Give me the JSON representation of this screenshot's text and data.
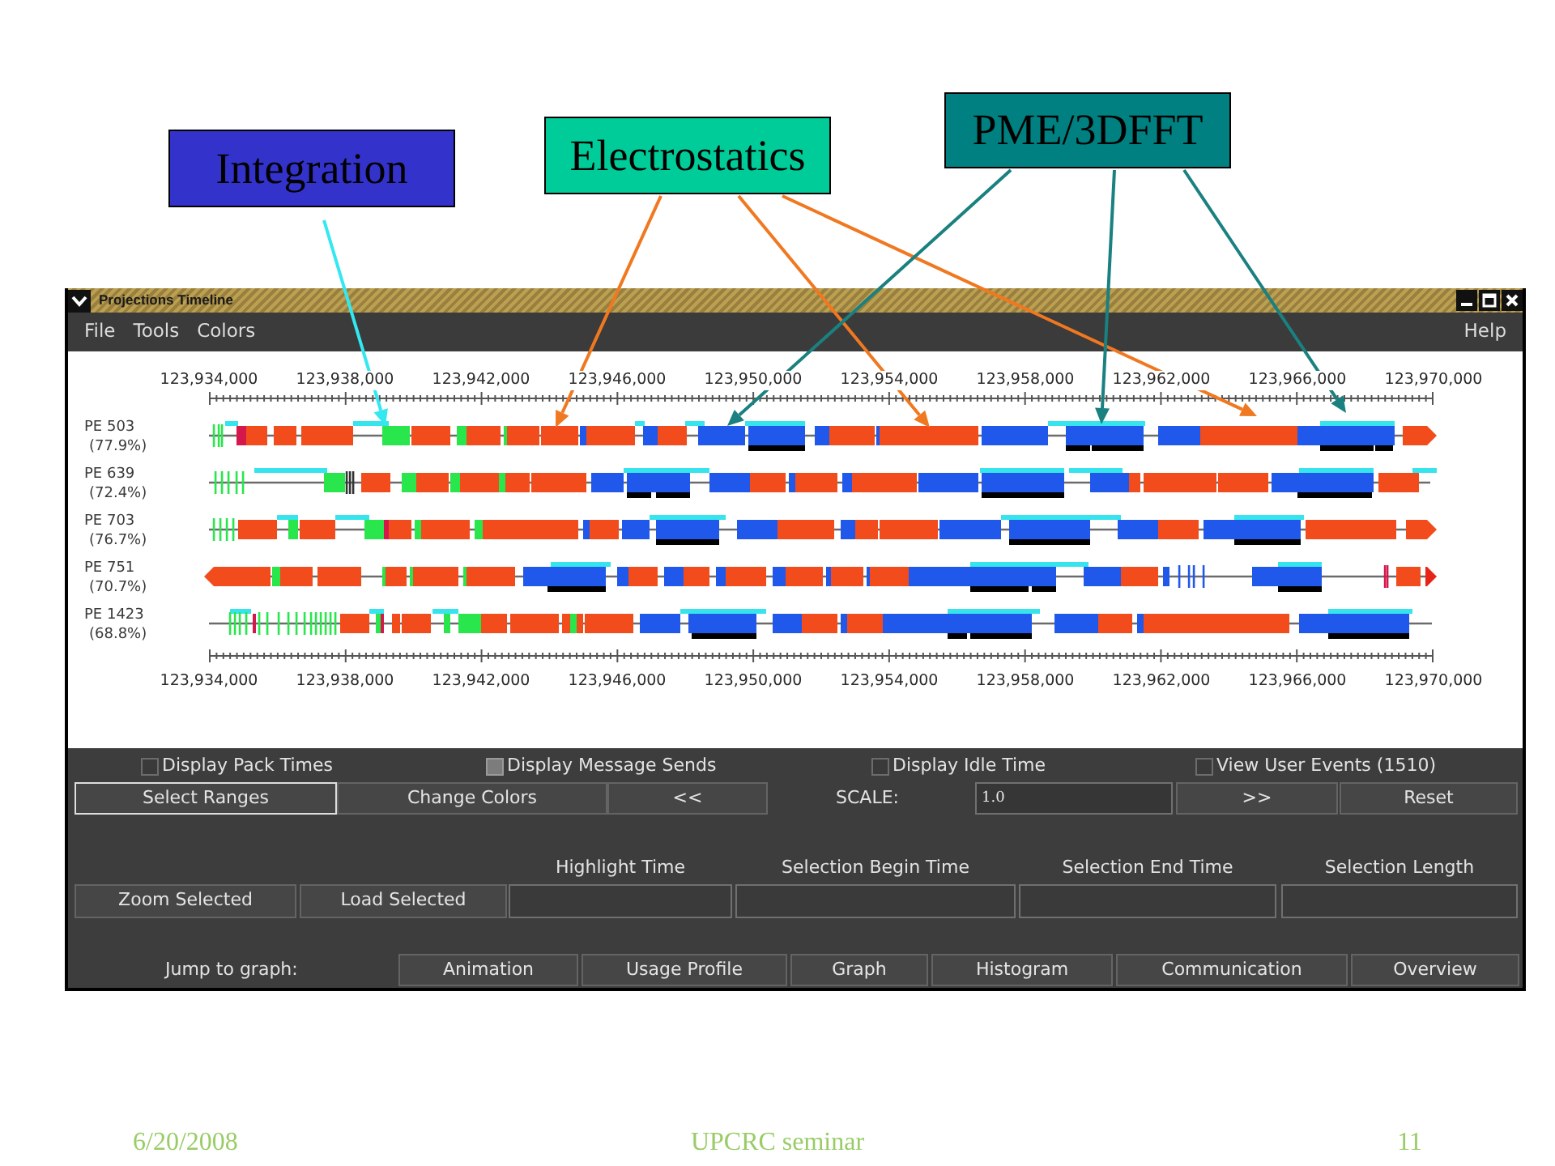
{
  "callouts": [
    {
      "label": "Integration",
      "color": "#3333cc",
      "arrows": [
        {
          "color": "#33e8f0"
        }
      ]
    },
    {
      "label": "Electrostatics",
      "color": "#00cc99",
      "arrows": [
        {
          "color": "#f07820"
        },
        {
          "color": "#f07820"
        },
        {
          "color": "#f07820"
        }
      ]
    },
    {
      "label": "PME/3DFFT",
      "color": "#008080",
      "arrows": [
        {
          "color": "#1a8080"
        },
        {
          "color": "#1a8080"
        },
        {
          "color": "#1a8080"
        }
      ]
    }
  ],
  "window": {
    "title": "Projections Timeline",
    "menus": [
      "File",
      "Tools",
      "Colors"
    ],
    "help_menu": "Help"
  },
  "timeline": {
    "top_axis_labels": [
      "123,934,000",
      "123,938,000",
      "123,942,000",
      "123,946,000",
      "123,950,000",
      "123,954,000",
      "123,958,000",
      "123,962,000",
      "123,966,000",
      "123,970,000"
    ],
    "rows": [
      {
        "processor": "PE 503",
        "utilization": "(77.9%)"
      },
      {
        "processor": "PE 639",
        "utilization": "(72.4%)"
      },
      {
        "processor": "PE 703",
        "utilization": "(76.7%)"
      },
      {
        "processor": "PE 751",
        "utilization": "(70.7%)"
      },
      {
        "processor": "PE 1423",
        "utilization": "(68.8%)"
      }
    ],
    "bottom_axis_labels": [
      "123,934,000",
      "123,938,000",
      "123,942,000",
      "123,946,000",
      "123,950,000",
      "123,954,000",
      "123,958,000",
      "123,962,000",
      "123,966,000",
      "123,970,000"
    ]
  },
  "display_options": [
    {
      "label": "Display Pack Times",
      "checked": false
    },
    {
      "label": "Display Message Sends",
      "checked": true
    },
    {
      "label": "Display Idle Time",
      "checked": false
    },
    {
      "label": "View User Events (1510)",
      "checked": false
    }
  ],
  "range_buttons": [
    {
      "label": "Select Ranges",
      "selected": true
    },
    {
      "label": "Change Colors",
      "selected": false
    },
    {
      "label": "<<",
      "selected": false
    }
  ],
  "scale": {
    "label": "SCALE:",
    "value": "1.0"
  },
  "scale_buttons": [
    {
      "label": ">>",
      "selected": false
    },
    {
      "label": "Reset",
      "selected": false
    }
  ],
  "selection_buttons": [
    "Zoom Selected",
    "Load Selected"
  ],
  "time_fields": [
    {
      "label": "Highlight Time"
    },
    {
      "label": "Selection Begin Time"
    },
    {
      "label": "Selection End Time"
    },
    {
      "label": "Selection Length"
    }
  ],
  "jump": {
    "label": "Jump to graph:",
    "buttons": [
      "Animation",
      "Usage Profile",
      "Graph",
      "Histogram",
      "Communication",
      "Overview"
    ]
  },
  "footer": {
    "date": "6/20/2008",
    "title": "UPCRC seminar",
    "page": "11"
  }
}
